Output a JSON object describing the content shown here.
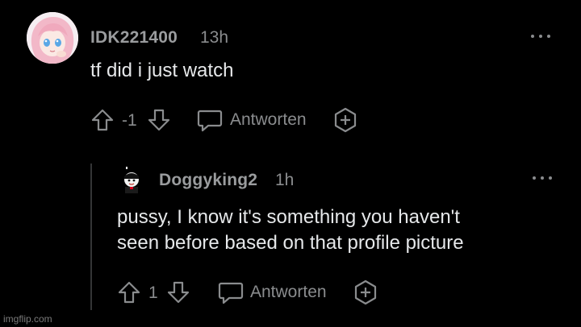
{
  "comment": {
    "username": "IDK221400",
    "time": "13h",
    "text": "tf did i just watch",
    "score": "-1",
    "reply_label": "Antworten"
  },
  "reply": {
    "username": "Doggyking2",
    "time": "1h",
    "text_line1": "pussy, I know it's something you haven't",
    "text_line2": "seen before based on that profile picture",
    "score": "1",
    "reply_label": "Antworten"
  },
  "watermark": "imgflip.com",
  "colors": {
    "background": "#000000",
    "text": "#e6e8ea",
    "muted": "#8a8c8e",
    "thread_line": "#343536"
  },
  "icons": [
    "upvote-icon",
    "downvote-icon",
    "comment-bubble-icon",
    "award-icon",
    "more-options-icon"
  ]
}
